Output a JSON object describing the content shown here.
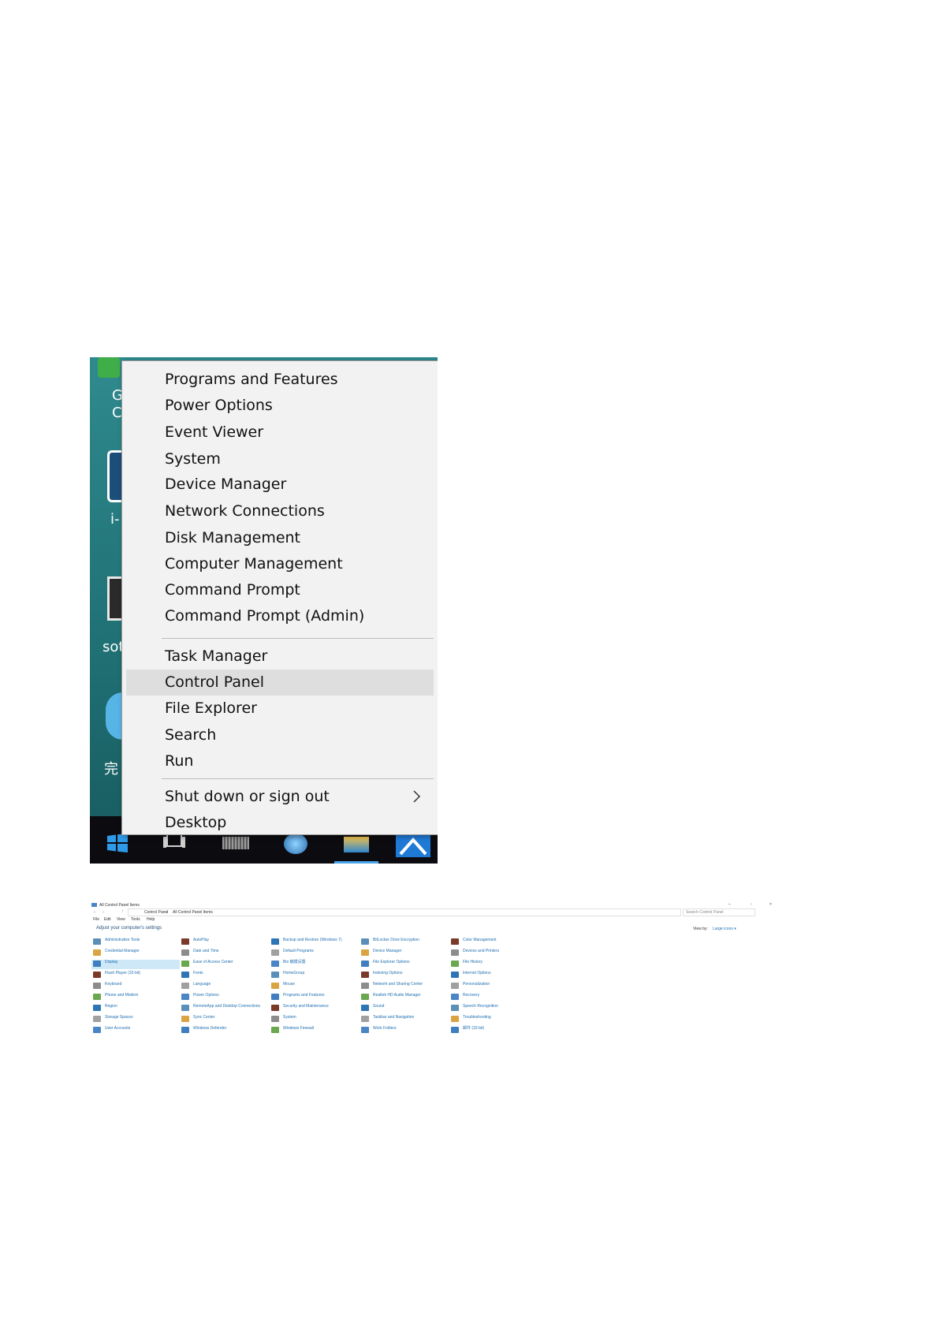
{
  "winx_menu": {
    "group1": [
      "Programs and Features",
      "Power Options",
      "Event Viewer",
      "System",
      "Device Manager",
      "Network Connections",
      "Disk Management",
      "Computer Management",
      "Command Prompt",
      "Command Prompt (Admin)"
    ],
    "group2": [
      "Task Manager",
      "Control Panel",
      "File Explorer",
      "Search",
      "Run"
    ],
    "highlighted": "Control Panel",
    "group3": [
      "Shut down or sign out",
      "Desktop"
    ]
  },
  "desktop": {
    "labels": [
      "G",
      "C",
      "i-",
      "sot",
      "完"
    ]
  },
  "control_panel": {
    "title": "All Control Panel Items",
    "breadcrumb": [
      "Control Panel",
      "All Control Panel Items"
    ],
    "search_placeholder": "Search Control Panel",
    "menu": [
      "File",
      "Edit",
      "View",
      "Tools",
      "Help"
    ],
    "heading": "Adjust your computer's settings",
    "view_by_label": "View by:",
    "view_by_value": "Large icons ▾",
    "columns": [
      [
        "Administrative Tools",
        "Credential Manager",
        "Display",
        "Flash Player (32-bit)",
        "Keyboard",
        "Phone and Modem",
        "Region",
        "Storage Spaces",
        "User Accounts"
      ],
      [
        "AutoPlay",
        "Date and Time",
        "Ease of Access Center",
        "Fonts",
        "Language",
        "Power Options",
        "RemoteApp and Desktop Connections",
        "Sync Center",
        "Windows Defender"
      ],
      [
        "Backup and Restore (Windows 7)",
        "Default Programs",
        "Bio 触摸设置",
        "HomeGroup",
        "Mouse",
        "Programs and Features",
        "Security and Maintenance",
        "System",
        "Windows Firewall"
      ],
      [
        "BitLocker Drive Encryption",
        "Device Manager",
        "File Explorer Options",
        "Indexing Options",
        "Network and Sharing Center",
        "Realtek HD Audio Manager",
        "Sound",
        "Taskbar and Navigation",
        "Work Folders"
      ],
      [
        "Color Management",
        "Devices and Printers",
        "File History",
        "Internet Options",
        "Personalization",
        "Recovery",
        "Speech Recognition",
        "Troubleshooting",
        "邮件 (32-bit)"
      ]
    ],
    "selected_item": "Display",
    "icon_colors": [
      "#5b8fb8",
      "#d9a441",
      "#3f7fbf",
      "#7a3a2a",
      "#8c8c8c",
      "#6aa84f",
      "#2e75b6",
      "#a0a0a0",
      "#4a86c5"
    ]
  }
}
